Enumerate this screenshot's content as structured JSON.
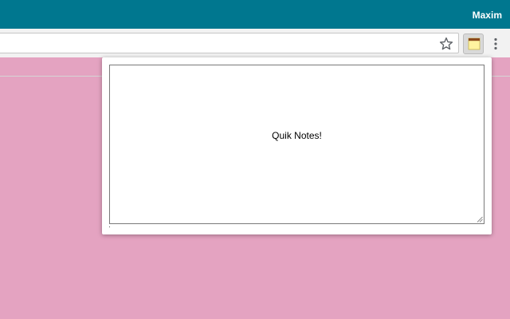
{
  "window": {
    "profile_name": "Maxim",
    "titlebar_color": "#00778f",
    "page_background": "#e4a3c1"
  },
  "toolbar": {
    "address_value": "",
    "bookmark_icon": "star-icon",
    "extension_icon": "notepad-icon",
    "menu_icon": "kebab-menu-icon"
  },
  "popup": {
    "note_text": "Quik Notes!"
  }
}
